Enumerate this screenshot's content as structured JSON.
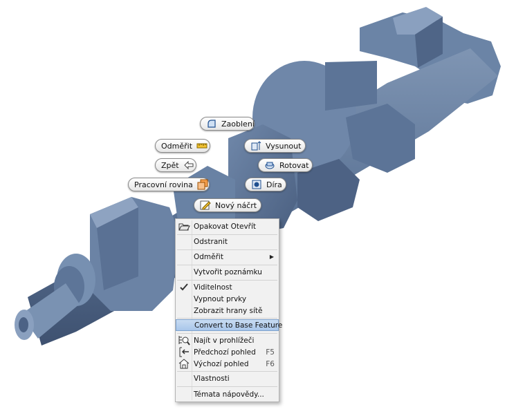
{
  "marking_menu": {
    "fillet": "Zaoblení",
    "measure": "Odměřit",
    "extrude": "Vysunout",
    "back": "Zpět",
    "revolve": "Rotovat",
    "work_plane": "Pracovní rovina",
    "hole": "Díra",
    "new_sketch": "Nový náčrt"
  },
  "context_menu": {
    "items": [
      {
        "label": "Opakovat Otevřít",
        "icon": "folder-open-icon"
      },
      {
        "label": "Odstranit"
      },
      {
        "label": "Odměřit",
        "submenu": true
      },
      {
        "label": "Vytvořit poznámku"
      },
      {
        "label": "Viditelnost",
        "checked": true
      },
      {
        "label": "Vypnout prvky"
      },
      {
        "label": "Zobrazit hrany sítě"
      },
      {
        "label": "Convert to Base Feature",
        "highlighted": true
      },
      {
        "label": "Najít v prohlížeči",
        "icon": "find-in-browser-icon"
      },
      {
        "label": "Předchozí pohled",
        "icon": "previous-view-icon",
        "shortcut": "F5"
      },
      {
        "label": "Výchozí pohled",
        "icon": "home-view-icon",
        "shortcut": "F6"
      },
      {
        "label": "Vlastnosti"
      },
      {
        "label": "Témata nápovědy..."
      }
    ]
  },
  "colors": {
    "model": "#5a7294",
    "highlight": "#b3cdef"
  }
}
